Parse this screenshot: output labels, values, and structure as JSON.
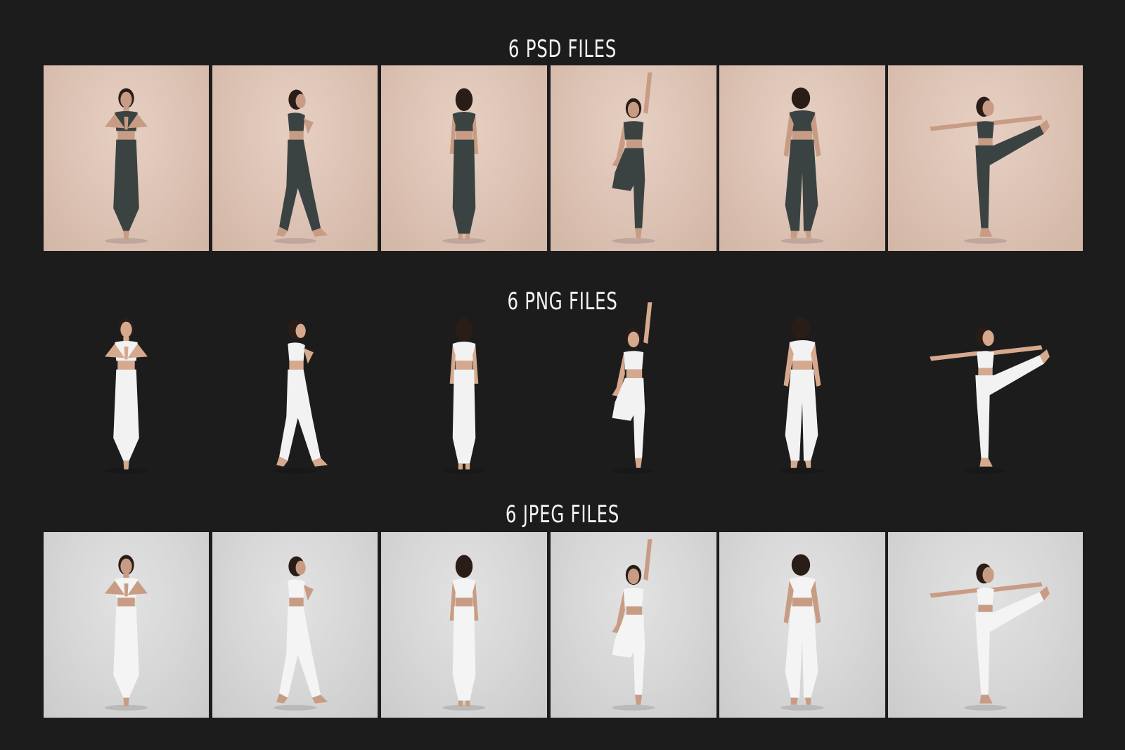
{
  "sections": {
    "psd": {
      "title": "6 PSD FILES",
      "count": 6,
      "background": "#dcc2b3",
      "outfit": "#3a4342",
      "skin": "#c89c84",
      "hair": "#2a1d18"
    },
    "png": {
      "title": "6 PNG FILES",
      "count": 6,
      "background": "#1c1c1c",
      "outfit": "#f2f2f2",
      "skin": "#d6a98e",
      "hair": "#2a1d18"
    },
    "jpeg": {
      "title": "6 JPEG FILES",
      "count": 6,
      "background": "#d6d6d6",
      "outfit": "#f4f4f4",
      "skin": "#c89c84",
      "hair": "#2a1d18"
    }
  },
  "poses": [
    "prayer-front",
    "prayer-side",
    "back",
    "tree-arm-up",
    "back-turned",
    "dancer-balance"
  ],
  "colors": {
    "page_background": "#1c1c1c",
    "title_text": "#f2f2f2"
  }
}
